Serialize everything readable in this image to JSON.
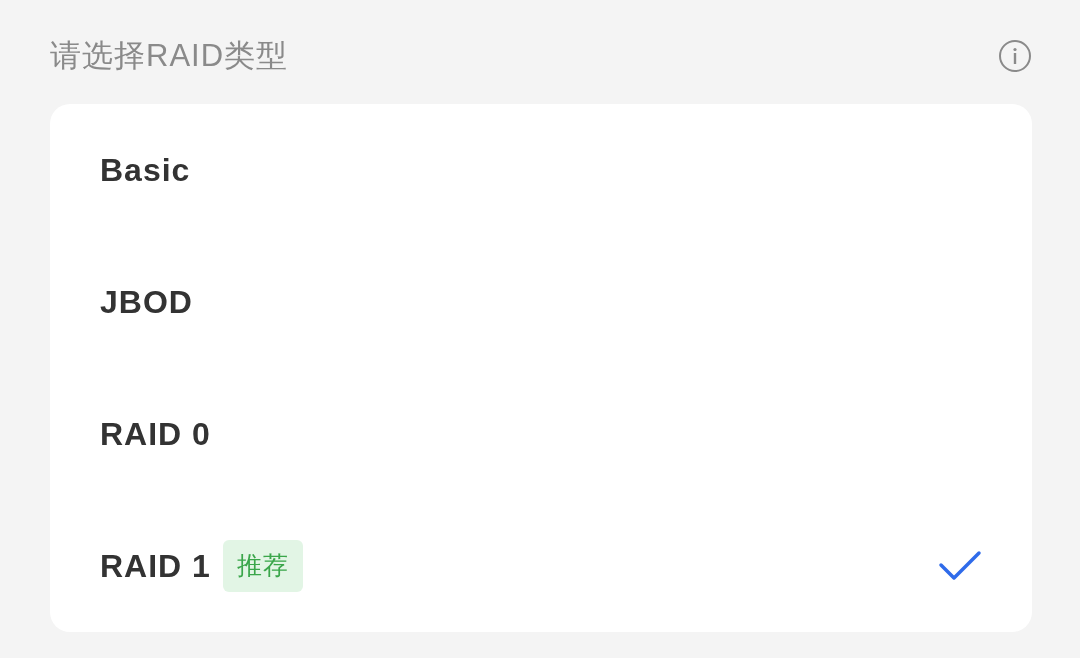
{
  "header": {
    "title": "请选择RAID类型"
  },
  "options": [
    {
      "label": "Basic",
      "selected": false
    },
    {
      "label": "JBOD",
      "selected": false
    },
    {
      "label": "RAID 0",
      "selected": false
    },
    {
      "label": "RAID 1",
      "badge": "推荐",
      "selected": true
    }
  ]
}
